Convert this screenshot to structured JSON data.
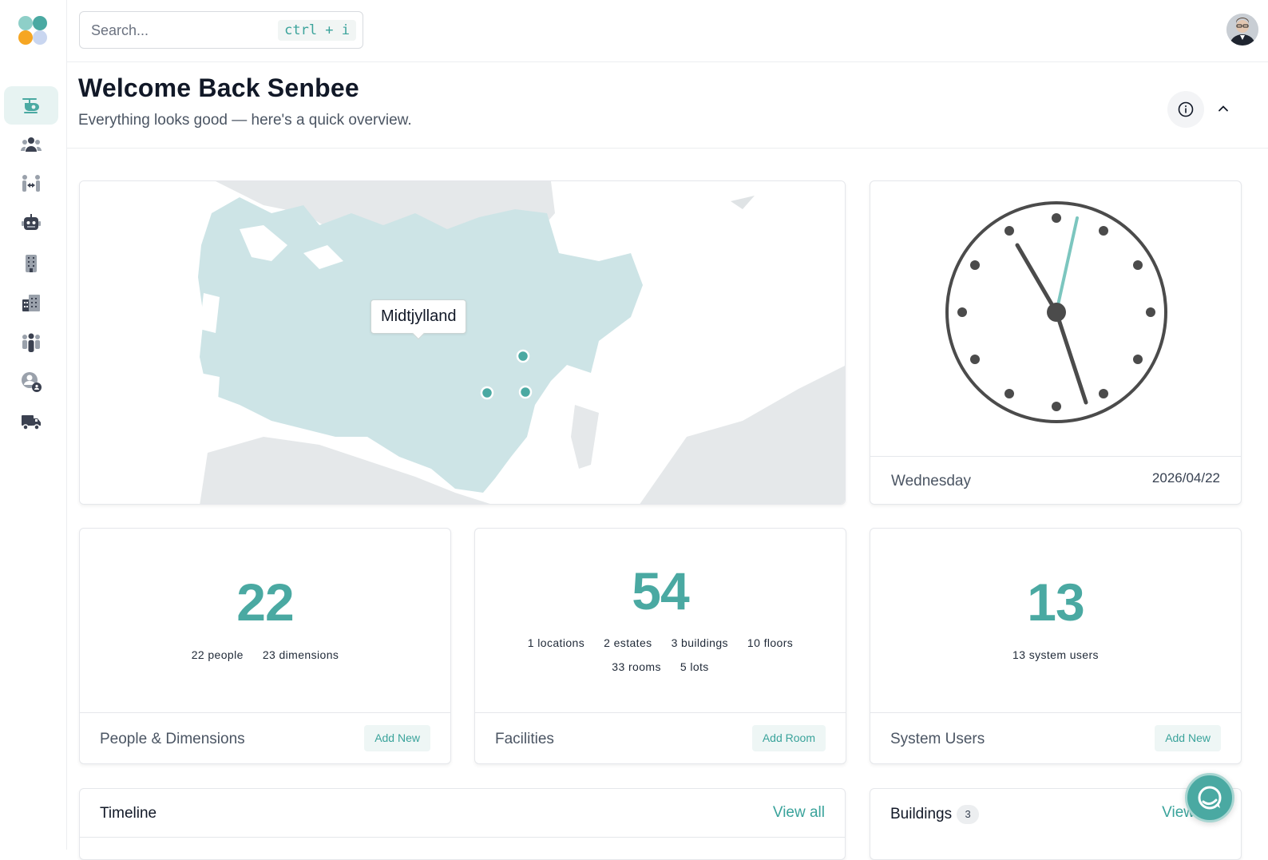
{
  "app": {
    "name": "Senbee"
  },
  "colors": {
    "accent": "#4aa9a2",
    "accent_light": "#e7f3f2",
    "text_dark": "#111827",
    "text_muted": "#4b5563"
  },
  "sidebar": {
    "items": [
      {
        "id": "dashboard",
        "icon": "helicopter-icon",
        "active": true
      },
      {
        "id": "people",
        "icon": "users-group-icon",
        "active": false
      },
      {
        "id": "transfers",
        "icon": "people-arrows-icon",
        "active": false
      },
      {
        "id": "robots",
        "icon": "robot-icon",
        "active": false
      },
      {
        "id": "building",
        "icon": "building-icon",
        "active": false
      },
      {
        "id": "city",
        "icon": "city-icon",
        "active": false
      },
      {
        "id": "users",
        "icon": "person-group-icon",
        "active": false
      },
      {
        "id": "user-admin",
        "icon": "user-lock-icon",
        "active": false
      },
      {
        "id": "shipping",
        "icon": "truck-icon",
        "active": false
      }
    ]
  },
  "topbar": {
    "search_placeholder": "Search...",
    "shortcut": "ctrl + i"
  },
  "header": {
    "title": "Welcome Back Senbee",
    "subtitle": "Everything looks good — here's a quick overview."
  },
  "map": {
    "tooltip": "Midtjylland",
    "markers": 3
  },
  "clock": {
    "day": "Wednesday",
    "date": "2026/04/22"
  },
  "stats": {
    "people": {
      "number": "22",
      "details": [
        "22 people",
        "23 dimensions"
      ],
      "title": "People & Dimensions",
      "action": "Add New"
    },
    "facilities": {
      "number": "54",
      "details_row1": [
        "1 locations",
        "2 estates",
        "3 buildings",
        "10 floors"
      ],
      "details_row2": [
        "33 rooms",
        "5 lots"
      ],
      "title": "Facilities",
      "action": "Add Room"
    },
    "system_users": {
      "number": "13",
      "details": [
        "13 system users"
      ],
      "title": "System Users",
      "action": "Add New"
    }
  },
  "timeline": {
    "title": "Timeline",
    "link": "View all"
  },
  "buildings": {
    "title": "Buildings",
    "count": "3",
    "link": "View"
  }
}
